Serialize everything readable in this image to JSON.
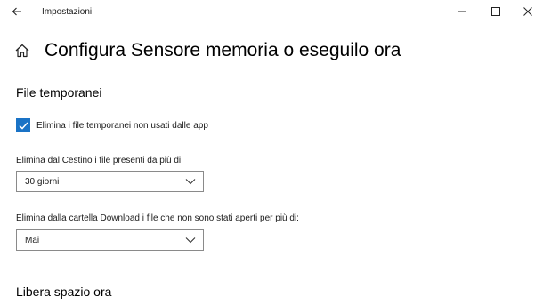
{
  "window": {
    "app_title": "Impostazioni",
    "back_icon": "back-arrow-icon",
    "controls": [
      "minimize-icon",
      "maximize-icon",
      "close-icon"
    ]
  },
  "page": {
    "title": "Configura Sensore memoria o eseguilo ora",
    "home_icon": "home-icon"
  },
  "temp_files": {
    "title": "File temporanei",
    "checkbox": {
      "label": "Elimina i file temporanei non usati dalle app",
      "checked": true
    },
    "recycle": {
      "label": "Elimina dal Cestino i file presenti da più di:",
      "value": "30 giorni"
    },
    "downloads": {
      "label": "Elimina dalla cartella Download i file che non sono stati aperti per più di:",
      "value": "Mai"
    }
  },
  "free_space": {
    "title": "Libera spazio ora"
  },
  "colors": {
    "accent": "#1a73c6",
    "text": "#000000",
    "border": "#8a8a8a"
  }
}
